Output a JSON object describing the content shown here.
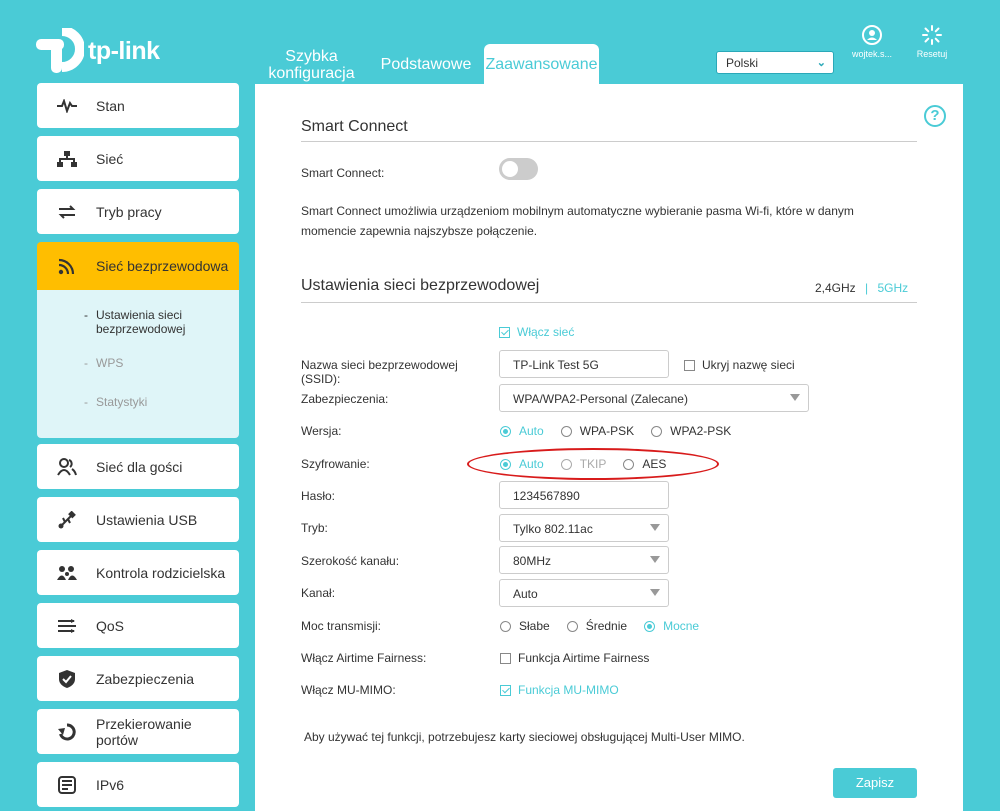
{
  "brand": {
    "logo_text": "tp-link"
  },
  "tabs": [
    {
      "label": "Szybka konfiguracja"
    },
    {
      "label": "Podstawowe"
    },
    {
      "label": "Zaawansowane"
    }
  ],
  "language": {
    "value": "Polski"
  },
  "header_icons": {
    "user": "wojtek.s...",
    "reset": "Resetuj"
  },
  "sidebar": {
    "items": [
      {
        "label": "Stan",
        "icon": "pulse-icon"
      },
      {
        "label": "Sieć",
        "icon": "network-icon"
      },
      {
        "label": "Tryb pracy",
        "icon": "switch-mode-icon"
      },
      {
        "label": "Sieć bezprzewodowa",
        "icon": "wifi-icon"
      },
      {
        "label": "Sieć dla gości",
        "icon": "guests-icon"
      },
      {
        "label": "Ustawienia USB",
        "icon": "usb-icon"
      },
      {
        "label": "Kontrola rodzicielska",
        "icon": "family-icon"
      },
      {
        "label": "QoS",
        "icon": "qos-icon"
      },
      {
        "label": "Zabezpieczenia",
        "icon": "shield-icon"
      },
      {
        "label": "Przekierowanie portów",
        "icon": "forwarding-icon"
      },
      {
        "label": "IPv6",
        "icon": "ipv6-icon"
      }
    ],
    "submenu": [
      {
        "label": "Ustawienia sieci bezprzewodowej"
      },
      {
        "label": "WPS"
      },
      {
        "label": "Statystyki"
      }
    ]
  },
  "smart_connect": {
    "title": "Smart Connect",
    "label": "Smart Connect:",
    "enabled": false,
    "description": "Smart Connect umożliwia urządzeniom mobilnym automatyczne wybieranie pasma Wi-fi, które w danym momencie zapewnia najszybsze połączenie."
  },
  "wireless": {
    "title": "Ustawienia sieci bezprzewodowej",
    "band_24": "2,4GHz",
    "band_sep": "|",
    "band_5": "5GHz",
    "enable_label": "Włącz sieć",
    "ssid_label": "Nazwa sieci bezprzewodowej (SSID):",
    "ssid_value": "TP-Link Test 5G",
    "hide_ssid_label": "Ukryj nazwę sieci",
    "security_label": "Zabezpieczenia:",
    "security_value": "WPA/WPA2-Personal (Zalecane)",
    "version_label": "Wersja:",
    "version_options": [
      "Auto",
      "WPA-PSK",
      "WPA2-PSK"
    ],
    "encryption_label": "Szyfrowanie:",
    "encryption_options": [
      "Auto",
      "TKIP",
      "AES"
    ],
    "password_label": "Hasło:",
    "password_value": "1234567890",
    "mode_label": "Tryb:",
    "mode_value": "Tylko 802.11ac",
    "width_label": "Szerokość kanału:",
    "width_value": "80MHz",
    "channel_label": "Kanał:",
    "channel_value": "Auto",
    "power_label": "Moc transmisji:",
    "power_options": [
      "Słabe",
      "Średnie",
      "Mocne"
    ],
    "airtime_label": "Włącz Airtime Fairness:",
    "airtime_option": "Funkcja Airtime Fairness",
    "mumimo_label": "Włącz MU-MIMO:",
    "mumimo_option": "Funkcja MU-MIMO",
    "mumimo_note": "Aby używać tej funkcji, potrzebujesz karty sieciowej obsługującej Multi-User MIMO.",
    "save_label": "Zapisz"
  },
  "colors": {
    "accent": "#4acbd6",
    "active_nav": "#ffbe00",
    "highlight": "#d81b1b"
  }
}
